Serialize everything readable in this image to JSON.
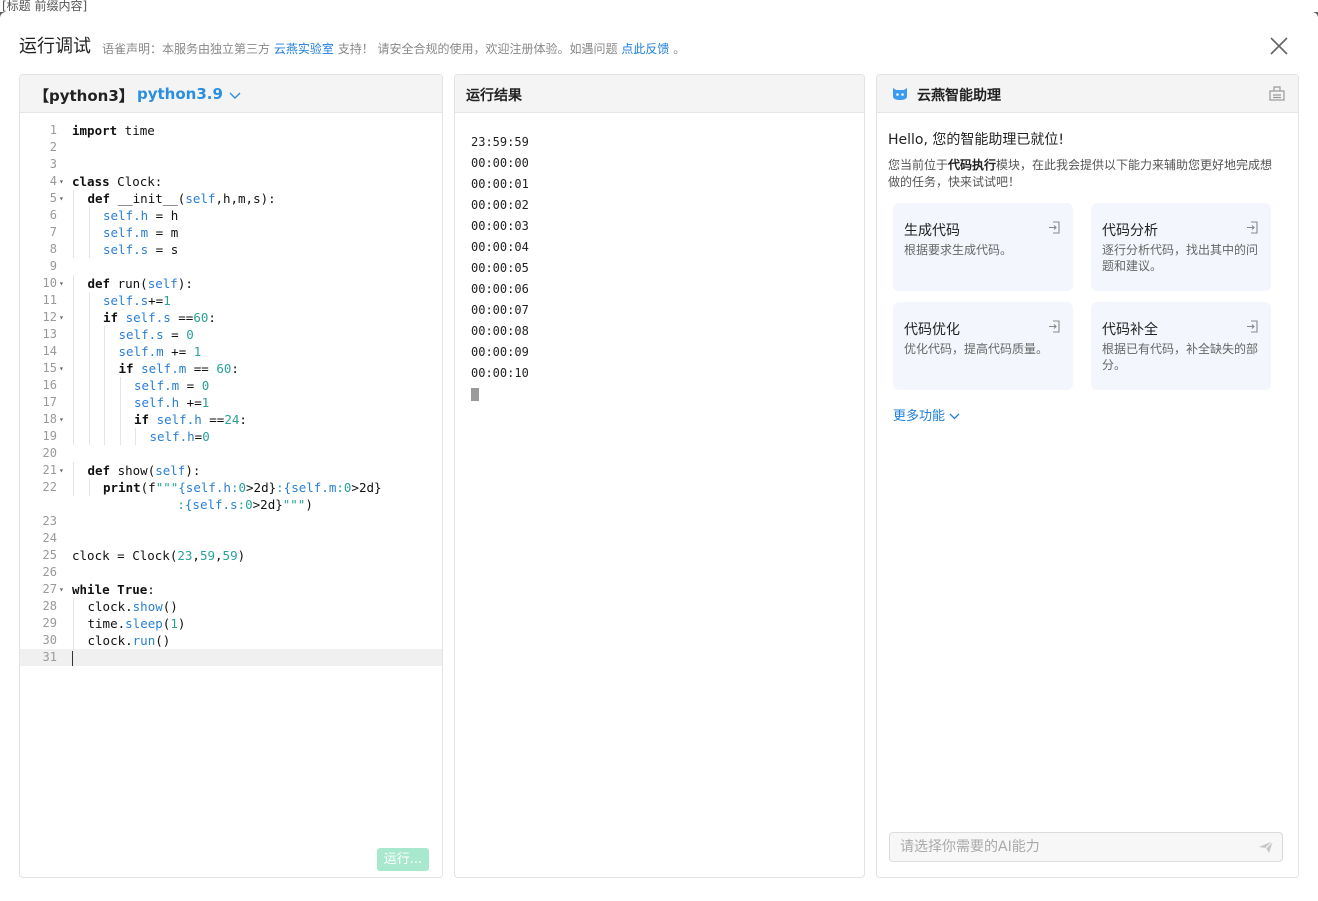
{
  "background": {
    "top_text": "[标题 前缀内容]"
  },
  "dialog": {
    "title": "运行调试",
    "note_prefix": "语雀声明：本服务由独立第三方",
    "note_link1": "云燕实验室",
    "note_mid": "支持！ 请安全合规的使用，欢迎注册体验。如遇问题",
    "note_link2": "点此反馈",
    "note_suffix": "。"
  },
  "editor": {
    "lang_tag": "【python3】",
    "lang_select": "python3.9",
    "run_label": "运行...",
    "lines": [
      {
        "n": "1",
        "fold": "",
        "indent": 0,
        "html": "<span class=\"kw\">import</span> time"
      },
      {
        "n": "2",
        "fold": "",
        "indent": 0,
        "html": ""
      },
      {
        "n": "3",
        "fold": "",
        "indent": 0,
        "html": ""
      },
      {
        "n": "4",
        "fold": "▾",
        "indent": 0,
        "html": "<span class=\"kw\">class</span> Clock:"
      },
      {
        "n": "5",
        "fold": "▾",
        "indent": 1,
        "html": "<span class=\"kw\">def</span> __init__(<span class=\"sf\">self</span>,h,m,s):"
      },
      {
        "n": "6",
        "fold": "",
        "indent": 2,
        "html": "<span class=\"sf\">self.h</span> = h"
      },
      {
        "n": "7",
        "fold": "",
        "indent": 2,
        "html": "<span class=\"sf\">self.m</span> = m"
      },
      {
        "n": "8",
        "fold": "",
        "indent": 2,
        "html": "<span class=\"sf\">self.s</span> = s"
      },
      {
        "n": "9",
        "fold": "",
        "indent": 0,
        "html": ""
      },
      {
        "n": "10",
        "fold": "▾",
        "indent": 1,
        "html": "<span class=\"kw\">def</span> run(<span class=\"sf\">self</span>):"
      },
      {
        "n": "11",
        "fold": "",
        "indent": 2,
        "html": "<span class=\"sf\">self.s</span>+=<span class=\"nm\">1</span>"
      },
      {
        "n": "12",
        "fold": "▾",
        "indent": 2,
        "html": "<span class=\"kw\">if</span> <span class=\"sf\">self.s</span> ==<span class=\"nm\">60</span>:"
      },
      {
        "n": "13",
        "fold": "",
        "indent": 3,
        "html": "<span class=\"sf\">self.s</span> = <span class=\"nm\">0</span>"
      },
      {
        "n": "14",
        "fold": "",
        "indent": 3,
        "html": "<span class=\"sf\">self.m</span> += <span class=\"nm\">1</span>"
      },
      {
        "n": "15",
        "fold": "▾",
        "indent": 3,
        "html": "<span class=\"kw\">if</span> <span class=\"sf\">self.m</span> == <span class=\"nm\">60</span>:"
      },
      {
        "n": "16",
        "fold": "",
        "indent": 4,
        "html": "<span class=\"sf\">self.m</span> = <span class=\"nm\">0</span>"
      },
      {
        "n": "17",
        "fold": "",
        "indent": 4,
        "html": "<span class=\"sf\">self.h</span> +=<span class=\"nm\">1</span>"
      },
      {
        "n": "18",
        "fold": "▾",
        "indent": 4,
        "html": "<span class=\"kw\">if</span> <span class=\"sf\">self.h</span> ==<span class=\"nm\">24</span>:"
      },
      {
        "n": "19",
        "fold": "",
        "indent": 5,
        "html": "<span class=\"sf\">self.h</span>=<span class=\"nm\">0</span>"
      },
      {
        "n": "20",
        "fold": "",
        "indent": 0,
        "html": ""
      },
      {
        "n": "21",
        "fold": "▾",
        "indent": 1,
        "html": "<span class=\"kw\">def</span> show(<span class=\"sf\">self</span>):"
      },
      {
        "n": "22",
        "fold": "",
        "indent": 2,
        "html": "<span class=\"kw\">print</span>(f<span class=\"nm\">\"\"\"</span><span class=\"sf\">{self.h</span><span class=\"nm\">:0</span>>2d}<span class=\"nm\">:</span><span class=\"sf\">{self.m</span><span class=\"nm\">:0</span>>2d}"
      },
      {
        "n": "",
        "fold": "",
        "indent": 0,
        "html": "              <span class=\"nm\">:</span><span class=\"sf\">{self.s</span><span class=\"nm\">:0</span>>2d}<span class=\"nm\">\"\"\"</span>)"
      },
      {
        "n": "23",
        "fold": "",
        "indent": 0,
        "html": ""
      },
      {
        "n": "24",
        "fold": "",
        "indent": 0,
        "html": ""
      },
      {
        "n": "25",
        "fold": "",
        "indent": 0,
        "html": "clock = Clock(<span class=\"nm\">23</span>,<span class=\"nm\">59</span>,<span class=\"nm\">59</span>)"
      },
      {
        "n": "26",
        "fold": "",
        "indent": 0,
        "html": ""
      },
      {
        "n": "27",
        "fold": "▾",
        "indent": 0,
        "html": "<span class=\"kw\">while</span> <span class=\"kw\">True</span>:"
      },
      {
        "n": "28",
        "fold": "",
        "indent": 1,
        "html": "clock.<span class=\"sf\">show</span>()"
      },
      {
        "n": "29",
        "fold": "",
        "indent": 1,
        "html": "time.<span class=\"sf\">sleep</span>(<span class=\"nm\">1</span>)"
      },
      {
        "n": "30",
        "fold": "",
        "indent": 1,
        "html": "clock.<span class=\"sf\">run</span>()"
      },
      {
        "n": "31",
        "fold": "",
        "indent": 0,
        "html": "",
        "current": true
      }
    ]
  },
  "result": {
    "title": "运行结果",
    "lines": [
      "23:59:59",
      "00:00:00",
      "00:00:01",
      "00:00:02",
      "00:00:03",
      "00:00:04",
      "00:00:05",
      "00:00:06",
      "00:00:07",
      "00:00:08",
      "00:00:09",
      "00:00:10"
    ]
  },
  "ai": {
    "name": "云燕智能助理",
    "hello": "Hello, 您的智能助理已就位!",
    "desc_prefix": "您当前位于",
    "desc_bold": "代码执行",
    "desc_suffix": "模块，在此我会提供以下能力来辅助您更好地完成想做的任务，快来试试吧！",
    "cards": [
      {
        "title": "生成代码",
        "desc": "根据要求生成代码。"
      },
      {
        "title": "代码分析",
        "desc": "逐行分析代码，找出其中的问题和建议。"
      },
      {
        "title": "代码优化",
        "desc": "优化代码，提高代码质量。"
      },
      {
        "title": "代码补全",
        "desc": "根据已有代码，补全缺失的部分。"
      }
    ],
    "more": "更多功能",
    "input_placeholder": "请选择你需要的AI能力",
    "accent": "#1e7fd8"
  }
}
